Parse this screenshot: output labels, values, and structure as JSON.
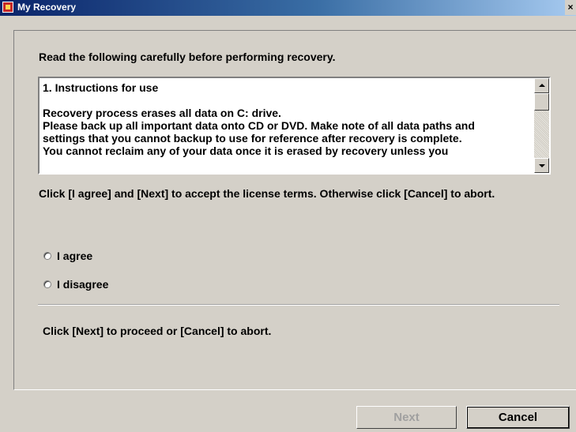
{
  "window": {
    "title": "My Recovery",
    "close_glyph": "×"
  },
  "intro_text": "Read the following carefully before performing recovery.",
  "license_text": {
    "heading": "1. Instructions for use",
    "lines": [
      "Recovery process erases all data on C: drive.",
      "Please back up all important data onto CD or DVD. Make note of all data paths and",
      "settings that you cannot backup to use for reference after recovery is complete.",
      "You cannot reclaim any of your data once it is erased by recovery unless you"
    ]
  },
  "license_note": "Click [I agree] and [Next] to accept the license terms. Otherwise click [Cancel] to abort.",
  "options": {
    "agree_label": "I agree",
    "disagree_label": "I disagree"
  },
  "proceed_note": "Click [Next] to proceed or [Cancel] to abort.",
  "buttons": {
    "next_label": "Next",
    "cancel_label": "Cancel"
  }
}
